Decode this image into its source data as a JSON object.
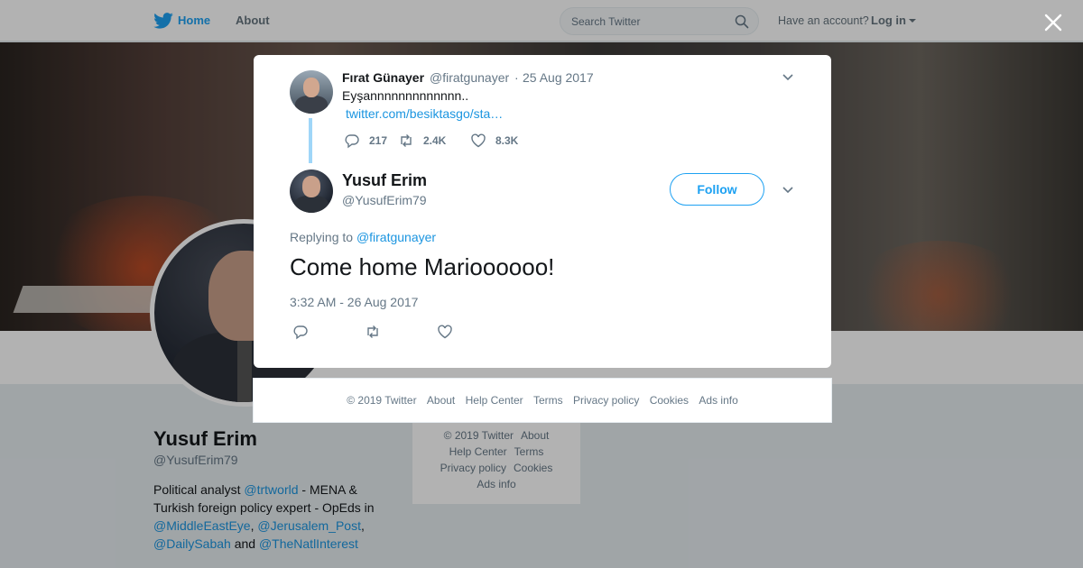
{
  "topbar": {
    "home": "Home",
    "about": "About",
    "search_placeholder": "Search Twitter",
    "have_account": "Have an account?",
    "login": "Log in"
  },
  "profile": {
    "name": "Yusuf Erim",
    "handle": "@YusufErim79",
    "bio": [
      {
        "t": "Political analyst ",
        "link": false
      },
      {
        "t": "@trtworld",
        "link": true
      },
      {
        "t": " - MENA & Turkish foreign policy expert - OpEds in ",
        "link": false
      },
      {
        "t": "@MiddleEastEye",
        "link": true
      },
      {
        "t": ", ",
        "link": false
      },
      {
        "t": "@Jerusalem_Post",
        "link": true
      },
      {
        "t": ", ",
        "link": false
      },
      {
        "t": "@DailySabah",
        "link": true
      },
      {
        "t": " and ",
        "link": false
      },
      {
        "t": "@TheNatlInterest",
        "link": true
      }
    ]
  },
  "side_footer": {
    "copyright": "© 2019 Twitter",
    "about": "About",
    "help": "Help Center",
    "terms": "Terms",
    "privacy": "Privacy policy",
    "cookies": "Cookies",
    "ads": "Ads info"
  },
  "parent_tweet": {
    "name": "Fırat Günayer",
    "handle": "@firatgunayer",
    "separator": "·",
    "date": "25 Aug 2017",
    "text": "Eyşannnnnnnnnnnnn..",
    "link": "twitter.com/besiktasgo/sta…",
    "replies": "217",
    "retweets": "2.4K",
    "likes": "8.3K"
  },
  "main_tweet": {
    "name": "Yusuf Erim",
    "handle": "@YusufErim79",
    "follow_label": "Follow",
    "replying_prefix": "Replying to",
    "replying_to": "@firatgunayer",
    "text": "Come home Marioooooo!",
    "timestamp": "3:32 AM - 26 Aug 2017"
  },
  "modal_footer": {
    "copyright": "© 2019 Twitter",
    "about": "About",
    "help": "Help Center",
    "terms": "Terms",
    "privacy": "Privacy policy",
    "cookies": "Cookies",
    "ads": "Ads info"
  },
  "colors": {
    "accent": "#1da1f2",
    "link": "#1b95e0",
    "secondary_text": "#657786",
    "thread_line": "#9fd6f8"
  },
  "icons": {
    "logo": "twitter-bird-icon",
    "search": "search-icon",
    "close": "close-icon",
    "reply": "reply-icon",
    "retweet": "retweet-icon",
    "like": "heart-icon",
    "more": "chevron-down-icon"
  }
}
